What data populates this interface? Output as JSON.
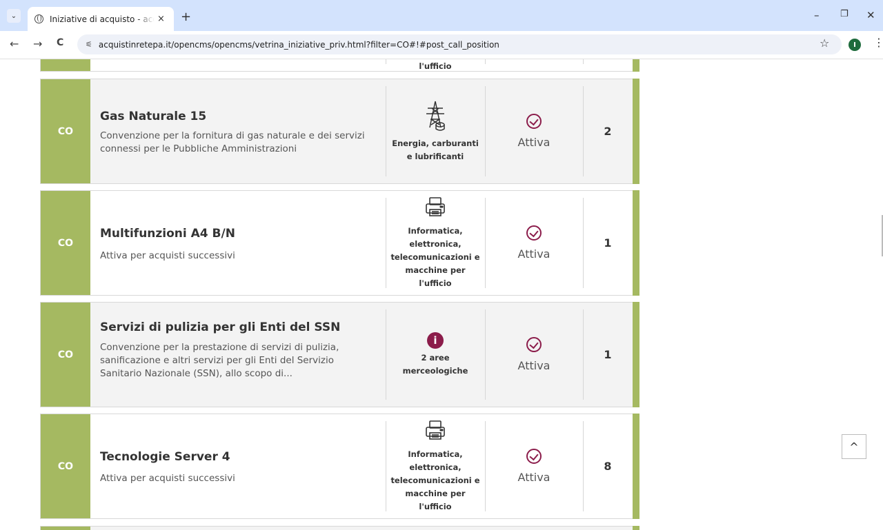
{
  "browser": {
    "tab_title": "Iniziative di acquisto - acquistinretepa",
    "tab_close": "×",
    "new_tab": "+",
    "tab_menu": "⌄",
    "url": "acquistinretepa.it/opencms/opencms/vetrina_iniziative_priv.html?filter=CO#!#post_call_position",
    "profile_initial": "I",
    "back": "←",
    "forward": "→",
    "reload": "C",
    "star": "☆",
    "menu": "⋮",
    "minimize": "–",
    "restore": "❐",
    "close": "✕"
  },
  "partial_row_top": {
    "category_tail": "l'ufficio"
  },
  "rows": [
    {
      "type": "CO",
      "title": "Gas Naturale 15",
      "description": "Convenzione per la fornitura di gas naturale e dei servizi connessi per le Pubbliche Amministrazioni",
      "category_icon": "power-pylon-icon",
      "category": "Energia, carburanti e lubrificanti",
      "status": "Attiva",
      "count": "2"
    },
    {
      "type": "CO",
      "title": "Multifunzioni A4 B/N",
      "description": "Attiva per acquisti successivi",
      "category_icon": "printer-icon",
      "category": "Informatica, elettronica, telecomunicazioni e macchine per l'ufficio",
      "status": "Attiva",
      "count": "1"
    },
    {
      "type": "CO",
      "title": "Servizi di pulizia per gli Enti del SSN",
      "description": "Convenzione per la prestazione di servizi di pulizia, sanificazione e altri servizi per gli Enti del Servizio Sanitario Nazionale (SSN), allo scopo di...",
      "category_icon": "info-icon",
      "category": "2 aree merceologiche",
      "status": "Attiva",
      "count": "1"
    },
    {
      "type": "CO",
      "title": "Tecnologie Server 4",
      "description": "Attiva per acquisti successivi",
      "category_icon": "printer-icon",
      "category": "Informatica, elettronica, telecomunicazioni e macchine per l'ufficio",
      "status": "Attiva",
      "count": "8"
    }
  ],
  "info_glyph": "i",
  "back_to_top": "^",
  "colors": {
    "type_bar": "#a5b961",
    "accent": "#8b1c4a",
    "row_bg": "#f3f3f3"
  }
}
